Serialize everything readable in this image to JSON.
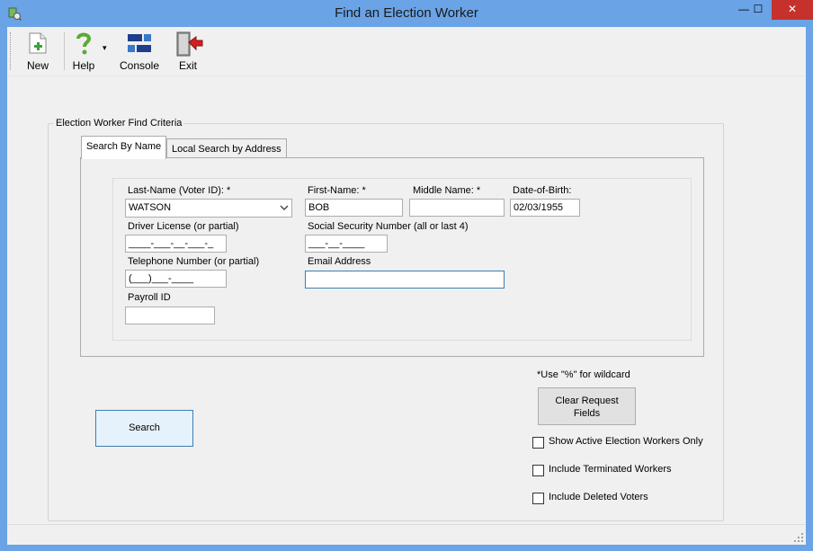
{
  "window": {
    "title": "Find an Election Worker",
    "controls": {
      "minimize": "—",
      "maximize": "☐",
      "close": "✕"
    }
  },
  "toolbar": {
    "items": [
      {
        "label": "New",
        "icon": "new-document-icon"
      },
      {
        "label": "Help",
        "icon": "help-question-icon"
      },
      {
        "label": "Console",
        "icon": "console-icon"
      },
      {
        "label": "Exit",
        "icon": "exit-door-icon"
      }
    ],
    "help_dropdown": "▾"
  },
  "criteria": {
    "group_title": "Election Worker Find Criteria",
    "tabs": [
      {
        "label": "Search By Name",
        "active": true
      },
      {
        "label": "Local Search by Address",
        "active": false
      }
    ],
    "fields": {
      "last_name": {
        "label": "Last-Name (Voter ID): *",
        "value": "WATSON"
      },
      "first_name": {
        "label": "First-Name: *",
        "value": "BOB"
      },
      "middle_name": {
        "label": "Middle Name: *",
        "value": ""
      },
      "dob": {
        "label": "Date-of-Birth:",
        "value": "02/03/1955"
      },
      "driver_license": {
        "label": "Driver License (or partial)",
        "value": "____-___-__-___-_"
      },
      "ssn": {
        "label": "Social Security Number (all or last 4)",
        "value": "___-__-____"
      },
      "telephone": {
        "label": "Telephone Number (or partial)",
        "value": "(___)___-____"
      },
      "email": {
        "label": "Email Address",
        "value": ""
      },
      "payroll_id": {
        "label": "Payroll ID",
        "value": ""
      }
    }
  },
  "actions": {
    "wildcard_hint": "*Use \"%\" for wildcard",
    "clear_button_line1": "Clear Request",
    "clear_button_line2": "Fields",
    "search_button": "Search"
  },
  "options": [
    {
      "label": "Show Active Election Workers Only",
      "checked": false
    },
    {
      "label": "Include Terminated Workers",
      "checked": false
    },
    {
      "label": "Include Deleted Voters",
      "checked": false
    }
  ],
  "colors": {
    "titlebar": "#6aa3e6",
    "close": "#c7312b",
    "focus_border": "#3c7fb1"
  }
}
